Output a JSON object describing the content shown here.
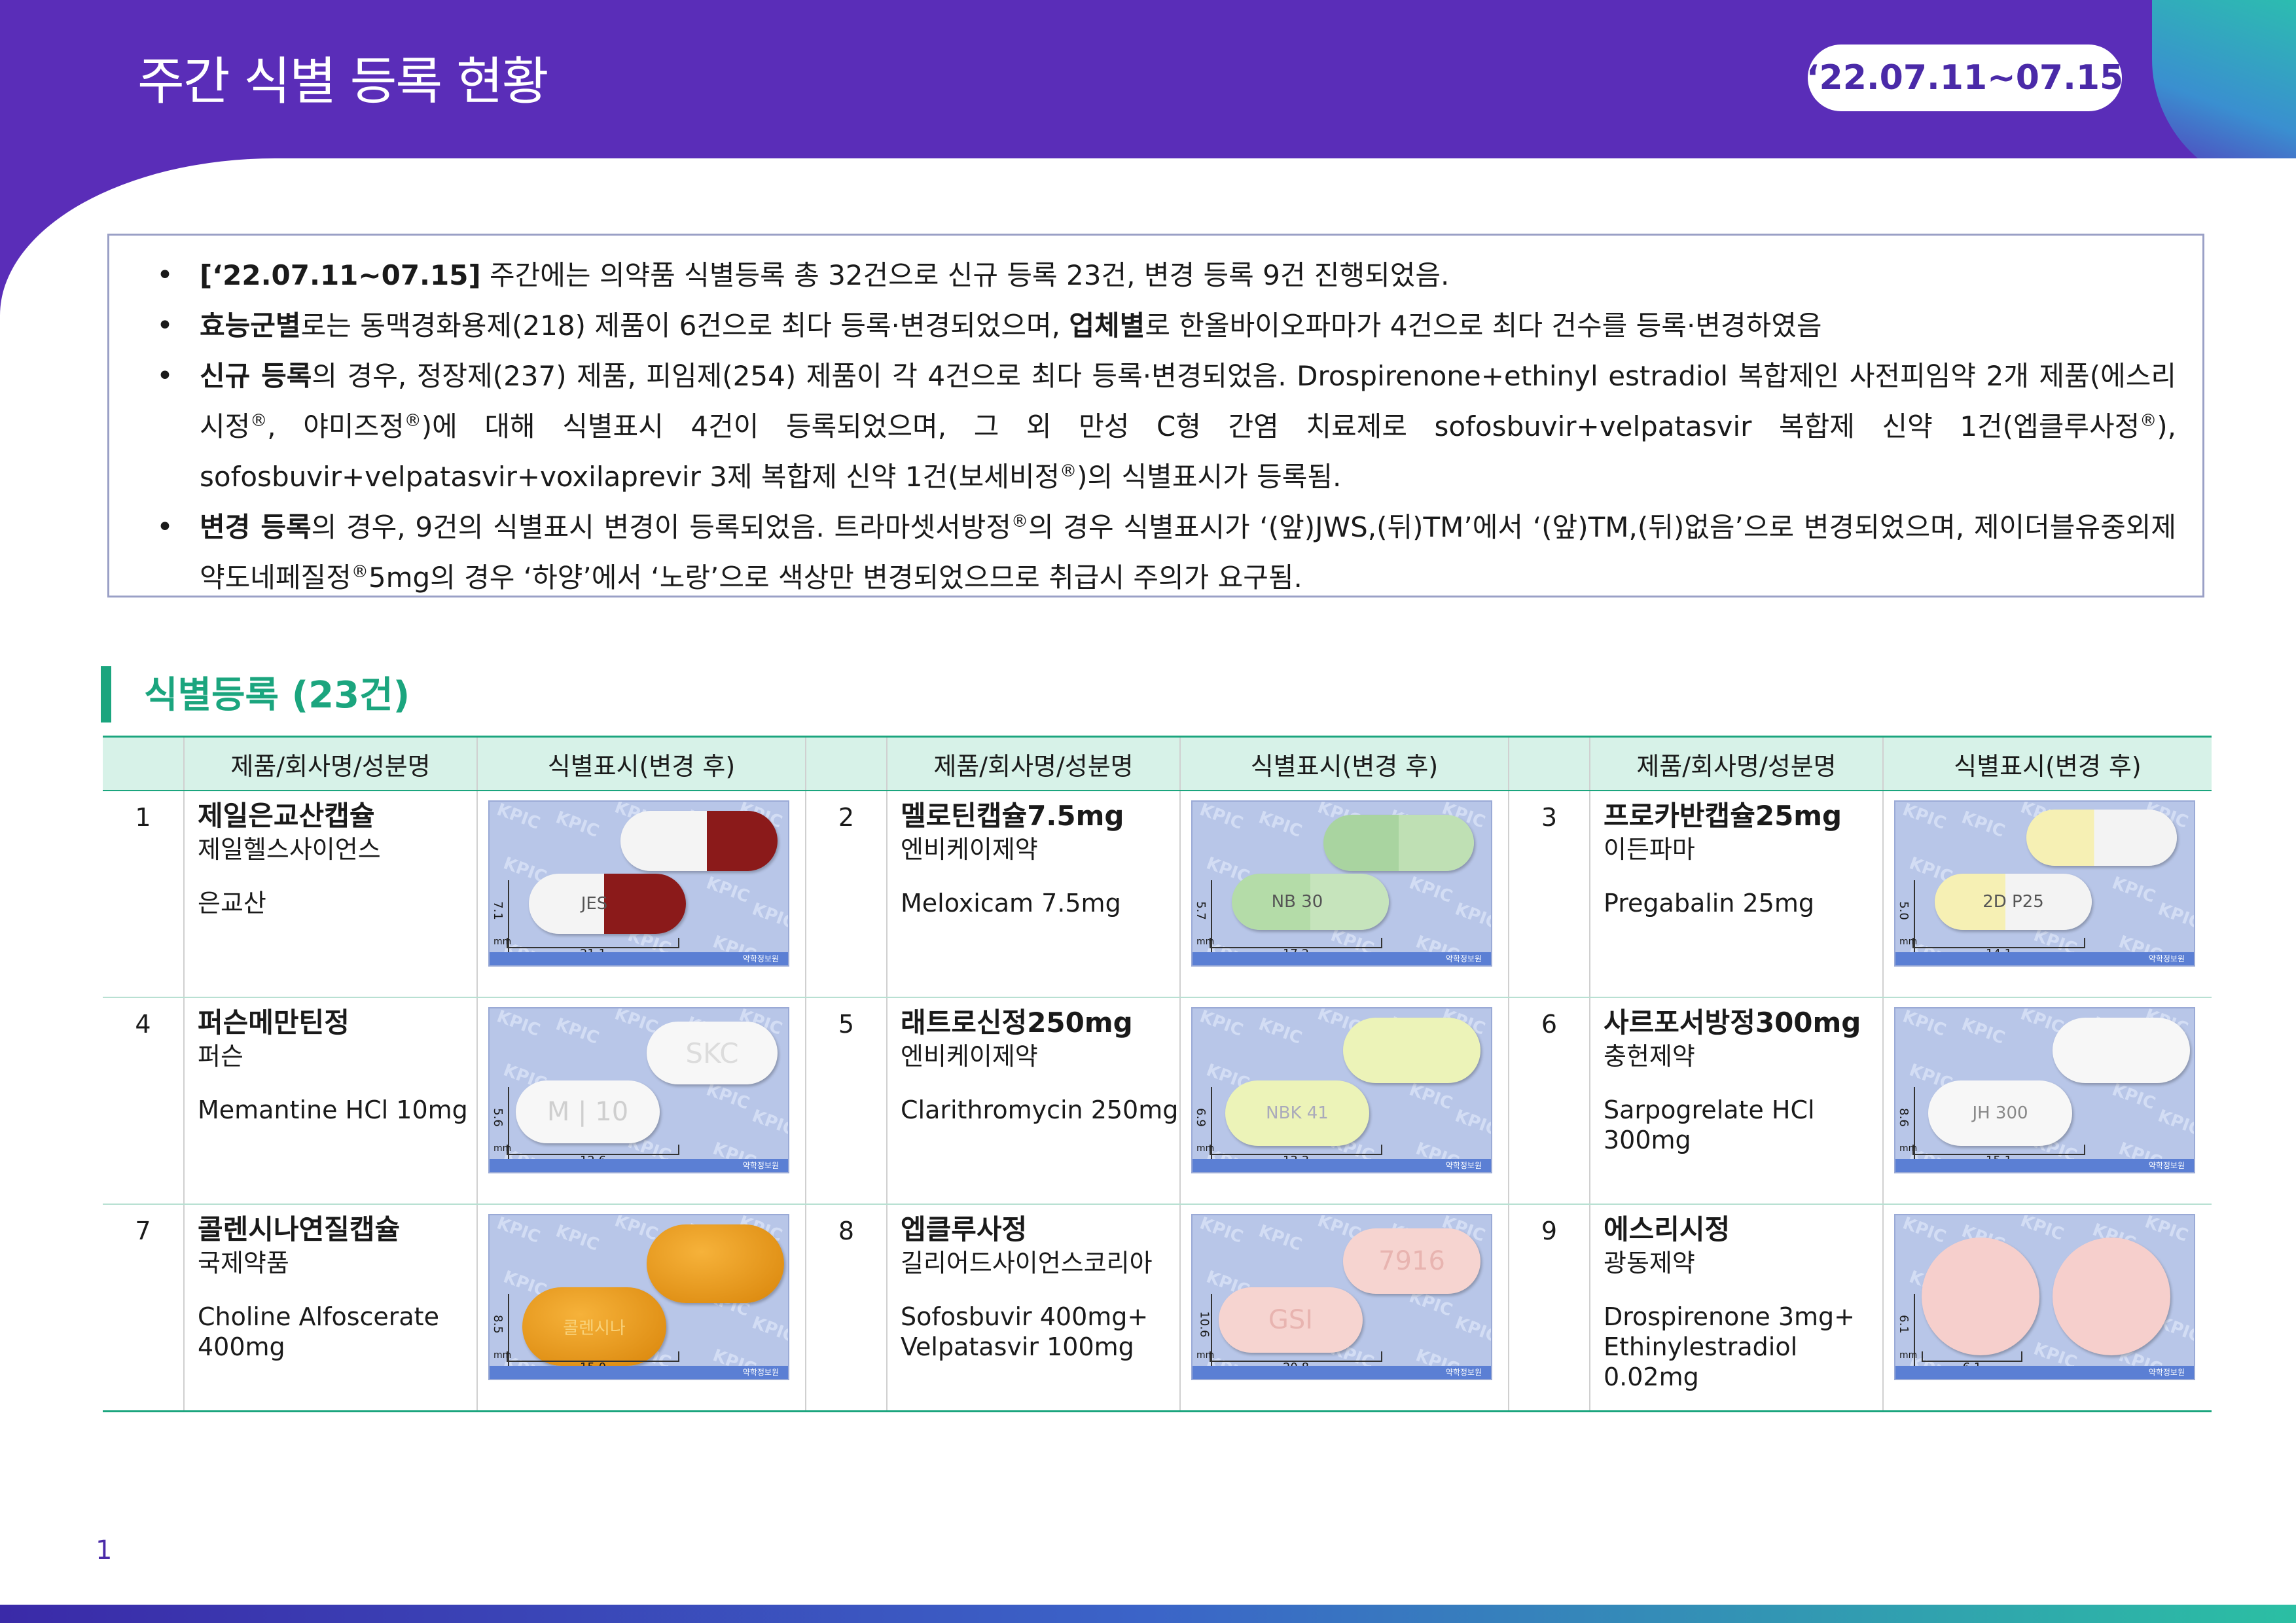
{
  "header": {
    "title": "주간 식별 등록 현황",
    "date_range": "‘22.07.11~07.15"
  },
  "summary": [
    {
      "bold": "[‘22.07.11~07.15]",
      "text": " 주간에는 의약품 식별등록 총 32건으로 신규 등록 23건, 변경 등록 9건 진행되었음."
    },
    {
      "bold": "효능군별",
      "text": "로는 동맥경화용제(218) 제품이 6건으로 최다 등록·변경되었으며, ",
      "bold2": "업체별",
      "text2": "로 한올바이오파마가 4건으로 최다 건수를 등록·변경하였음"
    },
    {
      "bold": "신규 등록",
      "text": "의 경우, 정장제(237) 제품, 피임제(254) 제품이 각 4건으로 최다 등록·변경되었음. Drospirenone+ethinyl estradiol 복합제인 사전피임약 2개 제품(에스리시정",
      "sup": "®",
      "text2": ", 야미즈정",
      "sup2": "®",
      "text3": ")에 대해 식별표시 4건이 등록되었으며, 그 외 만성 C형 간염 치료제로 sofosbuvir+velpatasvir 복합제 신약 1건(엡클루사정",
      "sup3": "®",
      "text4": "), sofosbuvir+velpatasvir+voxilaprevir 3제 복합제 신약 1건(보세비정",
      "sup4": "®",
      "text5": ")의 식별표시가 등록됨."
    },
    {
      "bold": "변경 등록",
      "text": "의 경우, 9건의 식별표시 변경이 등록되었음. 트라마셋서방정",
      "sup": "®",
      "text2": "의 경우 식별표시가 ‘(앞)JWS,(뒤)TM’에서 ‘(앞)TM,(뒤)없음’으로 변경되었으며, 제이더블유중외제약도네페질정",
      "sup2": "®",
      "text3": "5mg의 경우 ‘하양’에서 ‘노랑’으로 색상만 변경되었으므로 취급시 주의가 요구됨."
    }
  ],
  "section_title": "식별등록 (23건)",
  "table": {
    "col_product": "제품/회사명/성분명",
    "col_marking": "식별표시(변경 후)",
    "watermark": "KPIC",
    "mm_label": "mm",
    "footer_label": "약학정보원",
    "rows": [
      [
        {
          "no": "1",
          "name": "제일은교산캡슐",
          "company": "제일헬스사이언스",
          "ingredient": "은교산",
          "h": "7.1",
          "w": "21.1",
          "imprint": "JES"
        },
        {
          "no": "2",
          "name": "멜로틴캡슐7.5mg",
          "company": "엔비케이제약",
          "ingredient": "Meloxicam 7.5mg",
          "h": "5.7",
          "w": "17.2",
          "imprint": "NB 30"
        },
        {
          "no": "3",
          "name": "프로카반캡슐25mg",
          "company": "이든파마",
          "ingredient": "Pregabalin 25mg",
          "h": "5.0",
          "w": "14.1",
          "imprint": "2D  P25"
        }
      ],
      [
        {
          "no": "4",
          "name": "퍼슨메만틴정",
          "company": "퍼슨",
          "ingredient": "Memantine HCl 10mg",
          "h": "5.6",
          "w": "12.6",
          "imprint": "M | 10",
          "imprint2": "SKC"
        },
        {
          "no": "5",
          "name": "래트로신정250mg",
          "company": "엔비케이제약",
          "ingredient": "Clarithromycin 250mg",
          "h": "6.9",
          "w": "13.3",
          "imprint": "NBK 41"
        },
        {
          "no": "6",
          "name": "사르포서방정300mg",
          "company": "충헌제약",
          "ingredient": "Sarpogrelate HCl 300mg",
          "h": "8.6",
          "w": "15.1",
          "imprint": "JH 300"
        }
      ],
      [
        {
          "no": "7",
          "name": "콜렌시나연질캡슐",
          "company": "국제약품",
          "ingredient": "Choline Alfoscerate 400mg",
          "h": "8.5",
          "w": "15.0",
          "imprint": "콜렌시나"
        },
        {
          "no": "8",
          "name": "엡클루사정",
          "company": "길리어드사이언스코리아",
          "ingredient": "Sofosbuvir 400mg+ Velpatasvir 100mg",
          "h": "10.6",
          "w": "20.8",
          "imprint": "GSI",
          "imprint2": "7916"
        },
        {
          "no": "9",
          "name": "에스리시정",
          "company": "광동제약",
          "ingredient": "Drospirenone 3mg+ Ethinylestradiol 0.02mg",
          "h": "6.1",
          "w": "6.1",
          "imprint": ""
        }
      ]
    ]
  },
  "page_number": "1",
  "colors": {
    "header": "#5a2db8",
    "accent": "#1ba57e",
    "pill_bg": "#b8c6e8"
  }
}
